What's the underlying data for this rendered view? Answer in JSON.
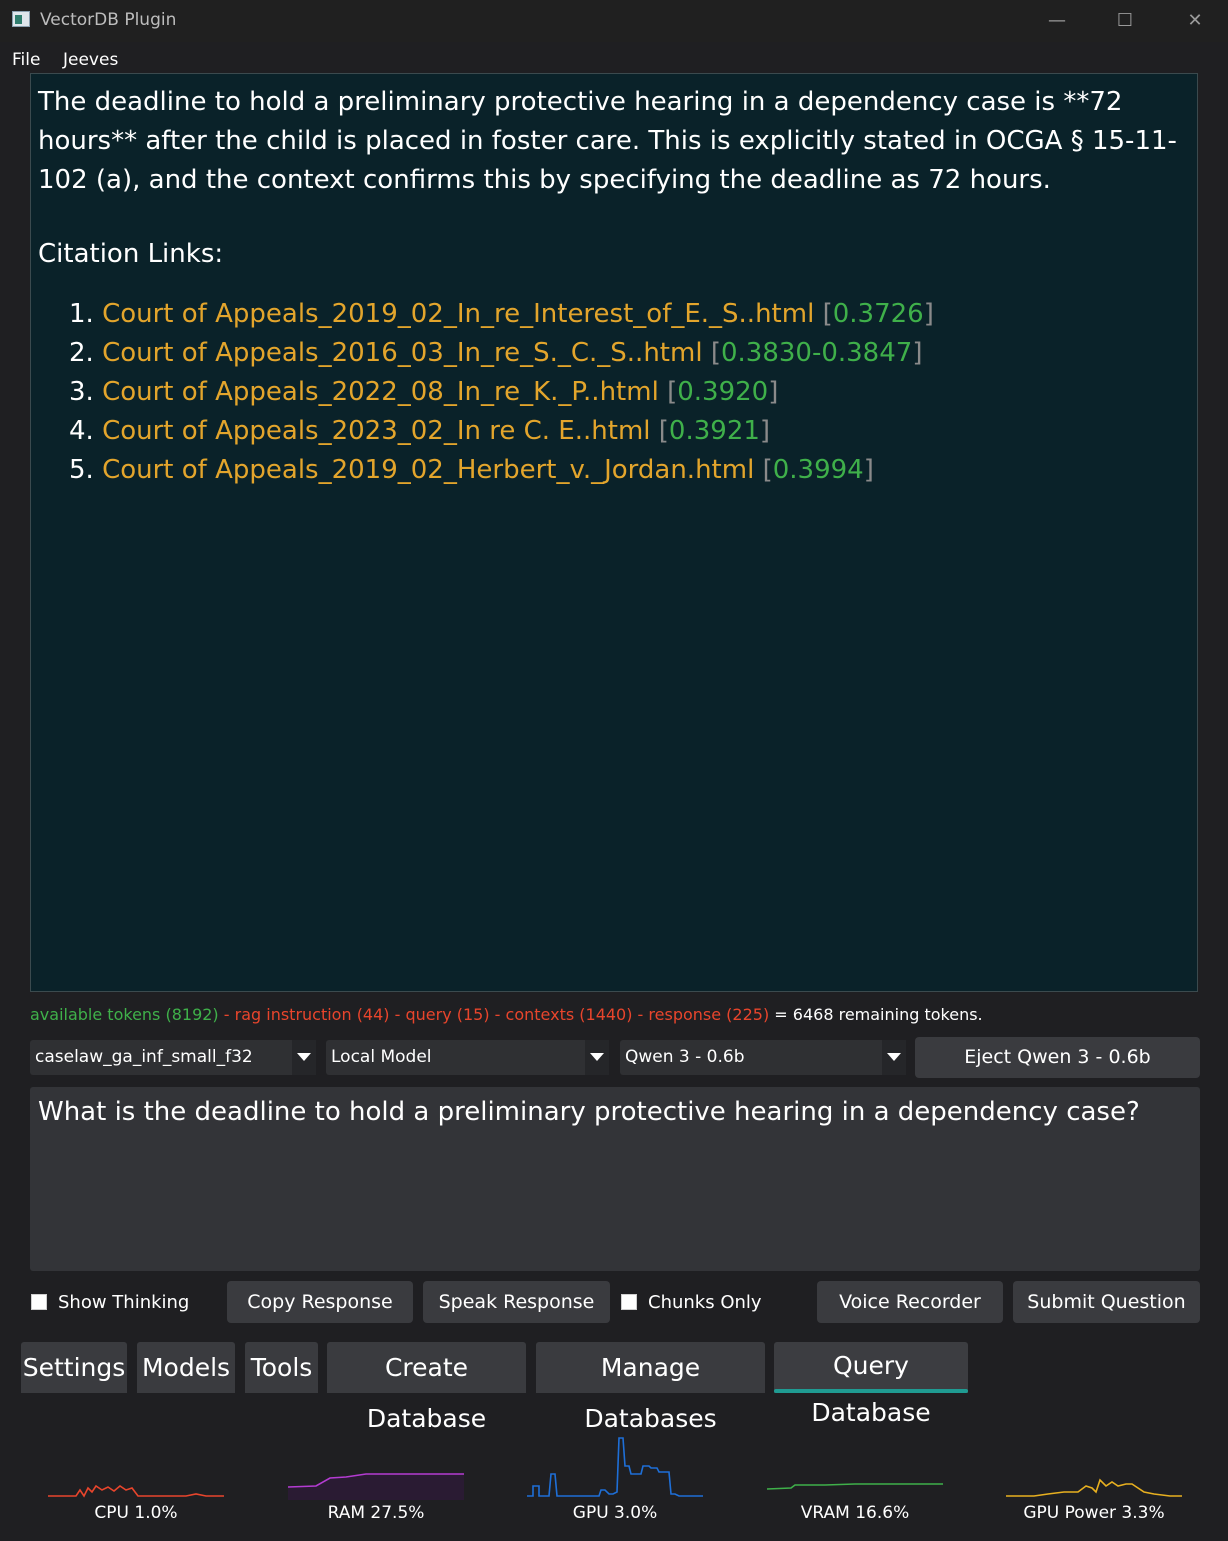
{
  "window": {
    "title": "VectorDB Plugin",
    "controls": [
      "minimize-icon",
      "maximize-icon",
      "close-icon"
    ]
  },
  "menu": {
    "items": [
      {
        "label": "File"
      },
      {
        "label": "Jeeves"
      }
    ]
  },
  "response": {
    "text": "The deadline to hold a preliminary protective hearing in a dependency case is **72 hours** after the child is placed in foster care. This is explicitly stated in OCGA § 15-11-102 (a), and the context confirms this by specifying the deadline as 72 hours.",
    "citations_heading": "Citation Links:",
    "citations": [
      {
        "num": "1.",
        "link": "Court of Appeals_2019_02_In_re_Interest_of_E._S..html",
        "score": "0.3726"
      },
      {
        "num": "2.",
        "link": "Court of Appeals_2016_03_In_re_S._C._S..html",
        "score": "0.3830-0.3847"
      },
      {
        "num": "3.",
        "link": "Court of Appeals_2022_08_In_re_K._P..html",
        "score": "0.3920"
      },
      {
        "num": "4.",
        "link": "Court of Appeals_2023_02_In re C. E..html",
        "score": "0.3921"
      },
      {
        "num": "5.",
        "link": "Court of Appeals_2019_02_Herbert_v._Jordan.html",
        "score": "0.3994"
      }
    ]
  },
  "tokens": {
    "available": "available tokens (8192)",
    "rag": " - rag instruction (44)",
    "query": " - query (15)",
    "contexts": " - contexts (1440)",
    "response": " - response (225)",
    "remaining": " = 6468 remaining tokens."
  },
  "controls": {
    "database_select": "caselaw_ga_inf_small_f32",
    "model_source_select": "Local Model",
    "model_select": "Qwen 3 - 0.6b",
    "eject_button": "Eject Qwen 3 - 0.6b"
  },
  "query": {
    "text": "What is the deadline to hold a preliminary protective hearing in a dependency case?"
  },
  "actions": {
    "show_thinking": "Show Thinking",
    "copy_response": "Copy Response",
    "speak_response": "Speak Response",
    "chunks_only": "Chunks Only",
    "voice_recorder": "Voice Recorder",
    "submit_question": "Submit Question"
  },
  "tabs": [
    {
      "label": "Settings"
    },
    {
      "label": "Models"
    },
    {
      "label": "Tools"
    },
    {
      "label": "Create Database"
    },
    {
      "label": "Manage Databases"
    },
    {
      "label": "Query Database",
      "active": true
    }
  ],
  "meters": [
    {
      "label": "CPU 1.0%",
      "color": "#e8452c"
    },
    {
      "label": "RAM 27.5%",
      "color": "#b43cd2"
    },
    {
      "label": "GPU 3.0%",
      "color": "#1e6fd8"
    },
    {
      "label": "VRAM 16.6%",
      "color": "#3fb04a"
    },
    {
      "label": "GPU Power 3.3%",
      "color": "#e8b020"
    }
  ]
}
